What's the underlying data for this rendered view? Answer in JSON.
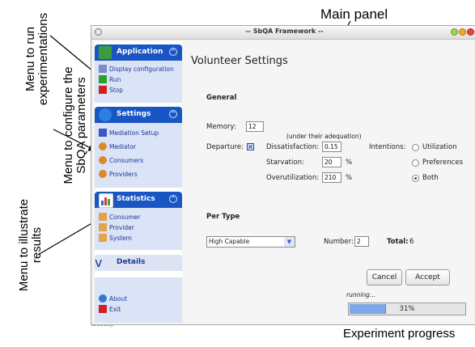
{
  "annotations": {
    "main_panel": "Main panel",
    "run_menu_1": "Menu to run",
    "run_menu_2": "experimentations",
    "config_menu_1": "Menu to configure the",
    "config_menu_2": "SbQA parameters",
    "stats_menu_1": "Menu to illustrate",
    "stats_menu_2": "results",
    "experiment_progress": "Experiment progress"
  },
  "window": {
    "title": "-- SbQA Framework --",
    "below_text": "toUtrue);"
  },
  "sidebar": {
    "application": {
      "header": "Application",
      "items": [
        "Display configuration",
        "Run",
        "Stop"
      ]
    },
    "settings": {
      "header": "Settings",
      "items": [
        "Mediation Setup",
        "Mediator",
        "Consumers",
        "Providers"
      ]
    },
    "statistics": {
      "header": "Statistics",
      "items": [
        "Consumer",
        "Provider",
        "System"
      ]
    },
    "details": {
      "header": "Details",
      "items": [
        "About",
        "Exit"
      ]
    }
  },
  "main": {
    "title": "Volunteer Settings",
    "general": {
      "heading": "General",
      "memory_label": "Memory:",
      "memory_value": "12",
      "adequation_note": "(under their adequation)",
      "departure_label": "Departure:",
      "departure_checked": true,
      "dissatisfaction_label": "Dissatisfaction:",
      "dissatisfaction_value": "0.15",
      "starvation_label": "Starvation:",
      "starvation_value": "20",
      "starvation_unit": "%",
      "overutilization_label": "Overutilization:",
      "overutilization_value": "210",
      "overutilization_unit": "%",
      "intentions_label": "Intentions:",
      "intentions_options": [
        "Utilization",
        "Preferences",
        "Both"
      ],
      "intentions_selected": "Both"
    },
    "per_type": {
      "heading": "Per Type",
      "type_selected": "High Capable",
      "number_label": "Number:",
      "number_value": "2",
      "total_label": "Total:",
      "total_value": "6"
    },
    "buttons": {
      "cancel": "Cancel",
      "accept": "Accept"
    },
    "status": {
      "text": "running...",
      "progress_fraction": 0.31,
      "progress_label": "31%"
    }
  },
  "colors": {
    "accent": "#1a55c4",
    "group_bg": "#dbe3f7",
    "progress_fill": "#7ea6e8"
  }
}
